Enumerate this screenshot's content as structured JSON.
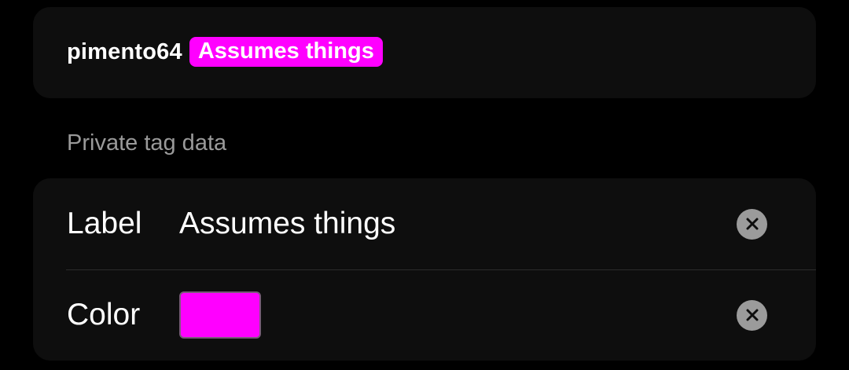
{
  "preview": {
    "username": "pimento64",
    "tag_label": "Assumes things",
    "tag_color": "#ff00ff"
  },
  "section": {
    "heading": "Private tag data"
  },
  "fields": {
    "label": {
      "name": "Label",
      "value": "Assumes things",
      "clear_icon": "close-circle-icon"
    },
    "color": {
      "name": "Color",
      "value": "#ff00ff",
      "clear_icon": "close-circle-icon"
    }
  }
}
